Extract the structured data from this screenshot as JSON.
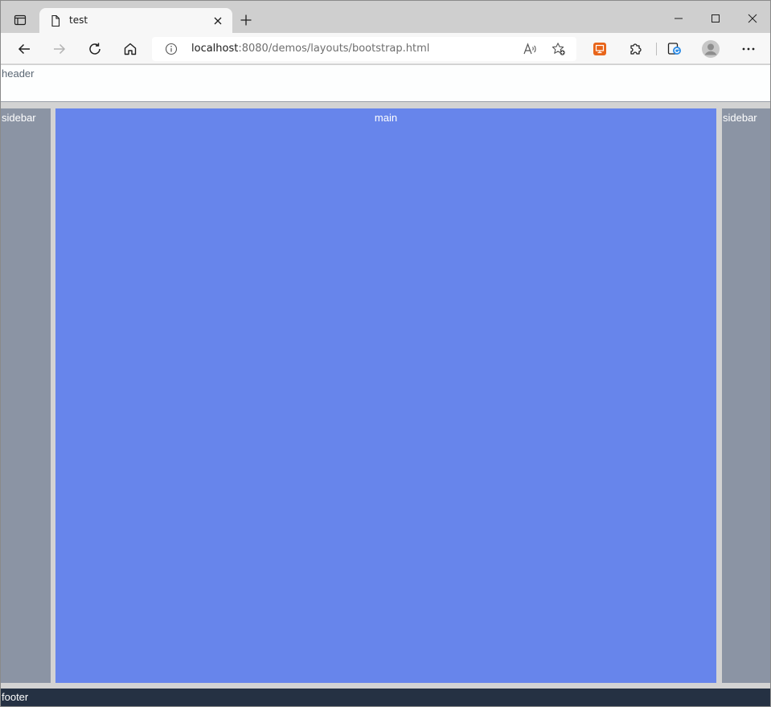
{
  "browser": {
    "tab_title": "test",
    "url_host": "localhost",
    "url_rest": ":8080/demos/layouts/bootstrap.html",
    "icons": {
      "tab_actions": "tab-actions-icon",
      "favicon": "page-icon",
      "tab_close": "close-icon",
      "new_tab": "plus-icon",
      "minimize": "minimize-icon",
      "maximize": "maximize-icon",
      "close_window": "close-window-icon",
      "back": "back-arrow-icon",
      "forward": "forward-arrow-icon",
      "refresh": "refresh-icon",
      "home": "home-icon",
      "site_info": "info-icon",
      "read_aloud": "read-aloud-icon",
      "favorites": "favorite-star-icon",
      "extension_orange": "monitor-icon",
      "extensions": "puzzle-icon",
      "collections": "collections-icon",
      "profile": "avatar-icon",
      "menu": "more-icon"
    }
  },
  "page": {
    "header": "header",
    "sidebar_left": "sidebar",
    "main": "main",
    "sidebar_right": "sidebar",
    "footer": "footer"
  },
  "colors": {
    "header_bg": "#fdfefe",
    "sidebar_bg": "#8b94a4",
    "main_bg": "#6785eb",
    "footer_bg": "#253143",
    "gutter": "#d3d3d3"
  }
}
